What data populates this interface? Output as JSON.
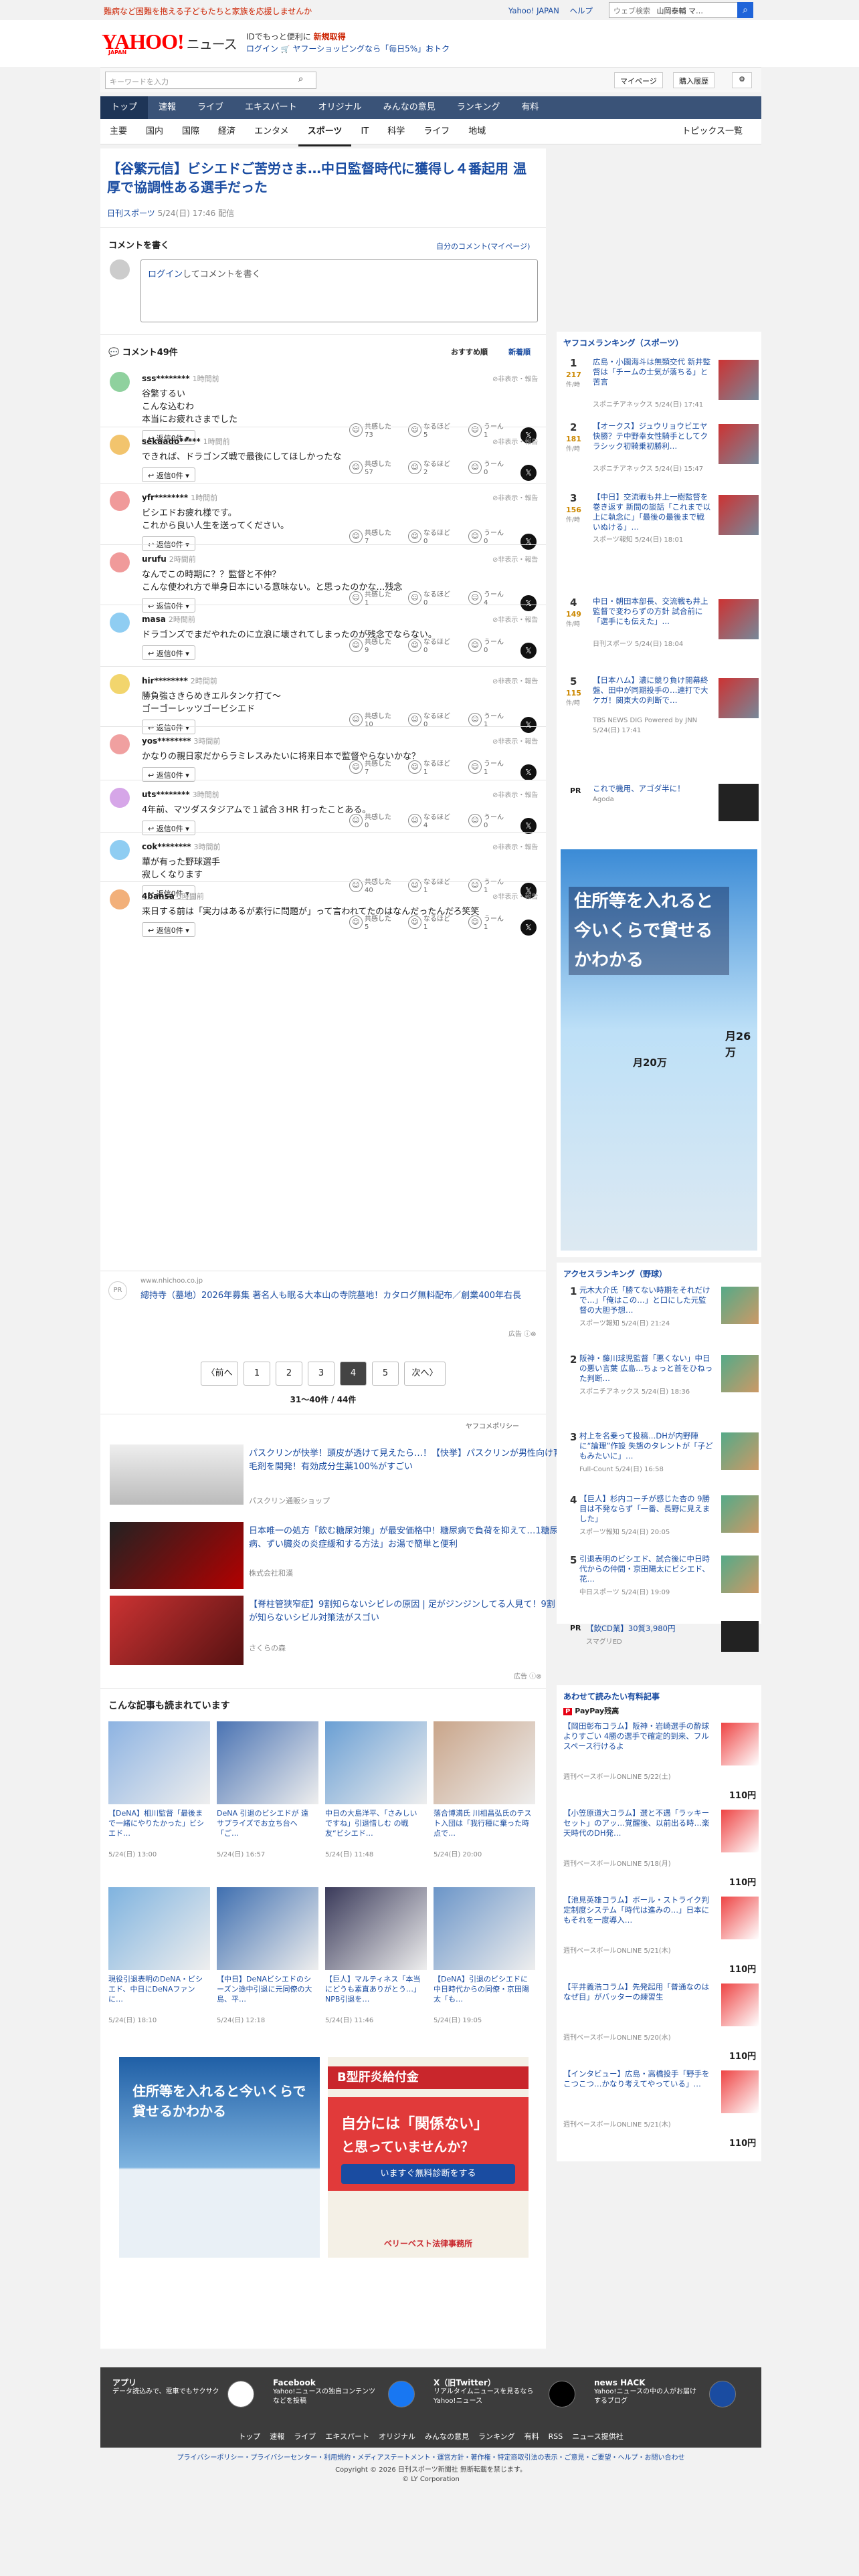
{
  "topbar": {
    "promo": "難病など困難を抱える子どもたちと家族を応援しませんか",
    "links": [
      "Yahoo! JAPAN",
      "ヘルプ"
    ],
    "search_placeholder": "ウェブ検索",
    "search_value": "山岡泰輔 マ…"
  },
  "header": {
    "logo": "YAHOO!",
    "logo_suffix": "ニュース",
    "logo_sub": "JAPAN",
    "tagline1": "IDでもっと便利に",
    "tagline1_b": "新規取得",
    "tagline2": "ログイン",
    "tagline2_rest": "ヤフーショッピングなら「毎日5%」おトク"
  },
  "searchbar": {
    "placeholder": "キーワードを入力",
    "mypage": "マイページ",
    "purchase": "購入履歴"
  },
  "nav": {
    "items": [
      "トップ",
      "速報",
      "ライブ",
      "エキスパート",
      "オリジナル",
      "みんなの意見",
      "ランキング",
      "有料"
    ]
  },
  "subnav": {
    "items": [
      "主要",
      "国内",
      "国際",
      "経済",
      "エンタメ",
      "スポーツ",
      "IT",
      "科学",
      "ライフ",
      "地域"
    ],
    "ranking": "トピックス一覧"
  },
  "article": {
    "title": "【谷繁元信】ビシエドご苦労さま…中日監督時代に獲得し４番起用 温厚で協調性ある選手だった",
    "source": "日刊スポーツ",
    "date": "5/24(日) 17:46 配信"
  },
  "comment_form": {
    "heading": "コメントを書く",
    "mylink": "自分のコメント(マイページ)",
    "login": "ログイン",
    "rest": "してコメントを書く"
  },
  "comments_header": {
    "count": "コメント49件",
    "sort1": "おすすめ順",
    "sort2": "新着順"
  },
  "comments": [
    {
      "name": "sss********",
      "time": "1時間前",
      "body": [
        "谷繁するい",
        "こんな込むわ",
        "本当にお疲れさまでした"
      ],
      "reply": "返信0件",
      "r1": "共感した",
      "n1": "73",
      "r2": "なるほど",
      "n2": "5",
      "r3": "うーん",
      "n3": "1"
    },
    {
      "name": "sekaado*****",
      "time": "1時間前",
      "body": [
        "できれば、ドラゴンズ戦で最後にしてほしかったな"
      ],
      "reply": "返信0件",
      "r1": "共感した",
      "n1": "57",
      "r2": "なるほど",
      "n2": "2",
      "r3": "うーん",
      "n3": "0"
    },
    {
      "name": "yfr********",
      "time": "1時間前",
      "body": [
        "ビシエドお疲れ様です。",
        "これから良い人生を送ってください。"
      ],
      "reply": "返信0件",
      "r1": "共感した",
      "n1": "7",
      "r2": "なるほど",
      "n2": "0",
      "r3": "うーん",
      "n3": "0"
    },
    {
      "name": "urufu",
      "time": "2時間前",
      "body": [
        "なんでこの時期に？？監督と不仲？",
        "こんな使われ方で単身日本にいる意味ない。と思ったのかな…残念"
      ],
      "reply": "返信0件",
      "r1": "共感した",
      "n1": "1",
      "r2": "なるほど",
      "n2": "0",
      "r3": "うーん",
      "n3": "4"
    },
    {
      "name": "masa",
      "time": "2時間前",
      "body": [
        "ドラゴンズでまだやれたのに立浪に壊されてしまったのが残念でならない。"
      ],
      "reply": "返信0件",
      "r1": "共感した",
      "n1": "9",
      "r2": "なるほど",
      "n2": "0",
      "r3": "うーん",
      "n3": "0"
    },
    {
      "name": "hir********",
      "time": "2時間前",
      "body": [
        "勝負強さきらめきエルタンケ打て〜",
        "ゴーゴーレッツゴービシエド"
      ],
      "reply": "返信0件",
      "r1": "共感した",
      "n1": "10",
      "r2": "なるほど",
      "n2": "0",
      "r3": "うーん",
      "n3": "1"
    },
    {
      "name": "yos********",
      "time": "3時間前",
      "body": [
        "かなりの親日家だからラミレスみたいに将来日本で監督やらないかな？"
      ],
      "reply": "返信0件",
      "r1": "共感した",
      "n1": "7",
      "r2": "なるほど",
      "n2": "1",
      "r3": "うーん",
      "n3": "1"
    },
    {
      "name": "uts********",
      "time": "3時間前",
      "body": [
        "4年前、マツダスタジアムで１試合３HR 打ったことある。"
      ],
      "reply": "返信0件",
      "r1": "共感した",
      "n1": "0",
      "r2": "なるほど",
      "n2": "4",
      "r3": "うーん",
      "n3": "0"
    },
    {
      "name": "cok********",
      "time": "3時間前",
      "body": [
        "華が有った野球選手",
        "寂しくなります"
      ],
      "reply": "返信0件",
      "r1": "共感した",
      "n1": "40",
      "r2": "なるほど",
      "n2": "1",
      "r3": "うーん",
      "n3": "1"
    },
    {
      "name": "4bansa",
      "time": "3時間前",
      "body": [
        "来日する前は「実力はあるが素行に問題が」って言われてたのはなんだったんだろ笑笑"
      ],
      "reply": "返信0件",
      "r1": "共感した",
      "n1": "5",
      "r2": "なるほど",
      "n2": "1",
      "r3": "うーん",
      "n3": "1"
    }
  ],
  "pr_comment": {
    "label": "PR",
    "url": "www.nhichoo.co.jp",
    "text": "總持寺（墓地）2026年募集 著名人も眠る大本山の寺院墓地！カタログ無料配布／創業400年右長"
  },
  "pagination": {
    "prev": "〈前へ",
    "pages": [
      "1",
      "2",
      "3",
      "4",
      "5"
    ],
    "next": "次へ〉",
    "info": "31〜40件 / 44件",
    "ad": "広告"
  },
  "ads": {
    "policy": "ヤフコメポリシー",
    "items": [
      {
        "text": "パスクリンが快挙！頭皮が透けて見えたら…！【快挙】パスクリンが男性向け育毛剤を開発！有効成分生薬100%がすごい",
        "src": "パスクリン通販ショップ"
      },
      {
        "text": "日本唯一の処方「飲む糖尿対策」が最安価格中！糖尿病で負荷を抑えて…1糖尿病、ずい臓炎の炎症緩和する方法」お湯で簡単と便利",
        "src": "株式会社和漢"
      },
      {
        "text": "【脊柱管狭窄症】9割知らないシビレの原因 | 足がジンジンしてる人見て！9割が知らないシビル対策法がスゴい",
        "src": "さくらの森"
      }
    ]
  },
  "related": {
    "heading": "こんな記事も読まれています",
    "items": [
      {
        "t": "【DeNA】相川監督「最後まで一緒にやりたかった」ビシエド…",
        "m": "5/24(日) 13:00"
      },
      {
        "t": "DeNA 引退のビシエドが 遠 サプライズでお立ち台へ「ご…",
        "m": "5/24(日) 16:57"
      },
      {
        "t": "中日の大島洋平、「さみしいですね」引退惜しむ の戦友“ビシエド…",
        "m": "5/24(日) 11:48"
      },
      {
        "t": "落合博満氏 川相昌弘氏のテスト入団は「我行種に棄った時点で…",
        "m": "5/24(日) 20:00"
      },
      {
        "t": "現役引退表明のDeNA・ビシエド、中日にDeNAファンに…",
        "m": "5/24(日) 18:10"
      },
      {
        "t": "【中日】DeNAビシエドのシーズン途中引退に元同僚の大島、平…",
        "m": "5/24(日) 12:18"
      },
      {
        "t": "【巨人】マルティネス「本当にどうも素直ありがとう…」NPB引退を…",
        "m": "5/24(日) 11:46"
      },
      {
        "t": "【DeNA】引退のビシエドに中日時代からの同僚・京田陽太「も…",
        "m": "5/24(日) 19:05"
      }
    ]
  },
  "bottom_ads": {
    "left_title": "住所等を入れると今いくらで貸せるかわかる",
    "right_title": "B型肝炎給付金",
    "right_big1": "自分には「関係ない」",
    "right_big2": "と思っていませんか？",
    "right_cta": "いますぐ無料診断をする",
    "right_brand": "ベリーベスト法律事務所"
  },
  "sidebar": {
    "rank_head": "ヤフコメランキング（スポーツ）",
    "ranking": [
      {
        "n": "1",
        "c": "217",
        "u": "件/時",
        "t": "広島・小園海斗は無類交代 新井監督は「チームの士気が落ちる」と苦言",
        "m": "スポニチアネックス 5/24(日) 17:41"
      },
      {
        "n": "2",
        "c": "181",
        "u": "件/時",
        "t": "【オークス】ジュウリョウビエヤ快勝？テ中野幸女性騎手としてクラシック初騎乗初勝利…",
        "m": "スポニチアネックス 5/24(日) 15:47"
      },
      {
        "n": "3",
        "c": "156",
        "u": "件/時",
        "t": "【中日】交流戦も井上一樹監督を巻き返す 新間の談話「これまで以上に執念に」「最後の最後まで戦いぬける」…",
        "m": "スポーツ報知 5/24(日) 18:01"
      },
      {
        "n": "4",
        "c": "149",
        "u": "件/時",
        "t": "中日・朝田本部長、交流戦も井上監督で変わらずの方針 試合前に「選手にも伝えた」…",
        "m": "日刊スポーツ 5/24(日) 18:04"
      },
      {
        "n": "5",
        "c": "115",
        "u": "件/時",
        "t": "【日本ハム】濃に競り負け開幕終盤、田中が同期投手の…連打で大ケガ！関東大の判断で…",
        "m": "TBS NEWS DIG Powered by JNN 5/24(日) 17:41"
      }
    ],
    "pr": {
      "label": "PR",
      "t": "これで機用、アゴダ半に！",
      "m": "Agoda"
    },
    "ad_title": "住所等を入れると今いくらで貸せるかわかる",
    "ad_price1": "月20万",
    "ad_price2": "月26万",
    "access_head": "アクセスランキング（野球）",
    "access": [
      {
        "n": "1",
        "t": "元木大介氏「勝てない時期をそれだけで…」「俺はこの…」と口にした元監督の大胆予想…",
        "m": "スポーツ報知 5/24(日) 21:24"
      },
      {
        "n": "2",
        "t": "阪神・藤川球児監督「悪くない」中日の悪い言葉 広島…ちょっと首をひねった判断…",
        "m": "スポニチアネックス 5/24(日) 18:36"
      },
      {
        "n": "3",
        "t": "村上を名乗って投稿…DHが内野陣に“論理”作設 失態のタレントが「子どもみたいに」…",
        "m": "Full-Count 5/24(日) 16:58"
      },
      {
        "n": "4",
        "t": "【巨人】杉内コーチが感じた杏の 9勝目は不発ならず「一番、長野に見えました」",
        "m": "スポーツ報知 5/24(日) 20:05"
      },
      {
        "n": "5",
        "t": "引退表明のビシエド、試合後に中日時代からの仲間・京田陽太にビシエド、花…",
        "m": "中日スポーツ 5/24(日) 19:09"
      }
    ],
    "pr2": {
      "label": "PR",
      "t": "【飲CD業】30質3,980円",
      "m": "スマグリED"
    },
    "paid_head": "あわせて読みたい有料記事",
    "paid_sub": "PayPay残高",
    "paid": [
      {
        "t": "【岡田彰布コラム】阪神・岩崎選手の酔球よりすごい 4勝の選手で確定的到来、フルスペース行けるよ",
        "m": "週刊ベースボールONLINE 5/22(土)",
        "p": "110円"
      },
      {
        "t": "【小笠原道大コラム】選と不遇「ラッキーセット」のアッ…覚醒後、以前出る時…楽天時代のDH発…",
        "m": "週刊ベースボールONLINE 5/18(月)",
        "p": "110円"
      },
      {
        "t": "【池見英雄コラム】ボール・ストライク判定制度システム「時代は進みの…」日本にもそれを一度導入…",
        "m": "週刊ベースボールONLINE 5/21(木)",
        "p": "110円"
      },
      {
        "t": "【平井義浩コラム】先発起用「普通なのはなぜ目」がバッターの練習生",
        "m": "週刊ベースボールONLINE 5/20(水)",
        "p": "110円"
      },
      {
        "t": "【インタビュー】広島・高橋投手「野手をこつこつ…かなり考えてやっている」…",
        "m": "週刊ベースボールONLINE 5/21(木)",
        "p": "110円"
      }
    ]
  },
  "footer": {
    "boxes": [
      {
        "title": "アプリ",
        "desc": "データ読込みで、電車でもサクサク"
      },
      {
        "title": "Facebook",
        "desc": "Yahoo!ニュースの独自コンテンツなどを投稿"
      },
      {
        "title": "X（旧Twitter）",
        "desc": "リアルタイムニュースを見るならYahoo!ニュース"
      },
      {
        "title": "news HACK",
        "desc": "Yahoo!ニュースの中の人がお届けするブログ"
      }
    ],
    "links": [
      "トップ",
      "速報",
      "ライブ",
      "エキスパート",
      "オリジナル",
      "みんなの意見",
      "ランキング",
      "有料",
      "RSS",
      "ニュース提供社"
    ],
    "legal": "プライバシーポリシー・プライバシーセンター・利用規約・メディアステートメント・運営方針・著作権・特定商取引法の表示・ご意見・ご要望・ヘルプ・お問い合わせ",
    "copy1": "Copyright © 2026 日刊スポーツ新聞社 無断転載を禁じます。",
    "copy2": "© LY Corporation"
  }
}
